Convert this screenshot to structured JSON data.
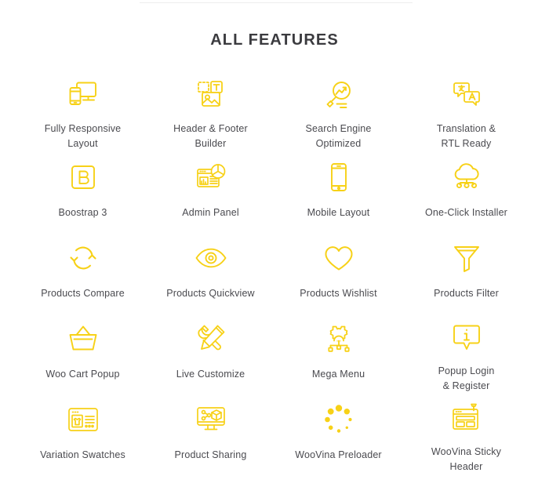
{
  "theme": {
    "icon_color": "#F7D117",
    "title_color": "#3b3b3f",
    "label_color": "#4a4a4f",
    "background": "#ffffff",
    "rule_color": "#ededee"
  },
  "header": {
    "title": "ALL FEATURES"
  },
  "features": [
    {
      "icon": "responsive-devices-icon",
      "label": "Fully Responsive\nLayout"
    },
    {
      "icon": "header-footer-builder-icon",
      "label": "Header & Footer\nBuilder"
    },
    {
      "icon": "magnifier-chart-icon",
      "label": "Search Engine\nOptimized"
    },
    {
      "icon": "translation-bubbles-icon",
      "label": "Translation &\nRTL Ready"
    },
    {
      "icon": "bootstrap-b-icon",
      "label": "Boostrap 3"
    },
    {
      "icon": "dashboard-chart-icon",
      "label": "Admin Panel"
    },
    {
      "icon": "mobile-phone-icon",
      "label": "Mobile Layout"
    },
    {
      "icon": "cloud-install-icon",
      "label": "One-Click Installer"
    },
    {
      "icon": "compare-arrows-icon",
      "label": "Products Compare"
    },
    {
      "icon": "eye-icon",
      "label": "Products Quickview"
    },
    {
      "icon": "heart-icon",
      "label": "Products Wishlist"
    },
    {
      "icon": "funnel-icon",
      "label": "Products Filter"
    },
    {
      "icon": "shopping-basket-icon",
      "label": "Woo Cart Popup"
    },
    {
      "icon": "wrench-pencil-icon",
      "label": "Live Customize"
    },
    {
      "icon": "gear-network-icon",
      "label": "Mega Menu"
    },
    {
      "icon": "info-bubble-icon",
      "label": "Popup Login\n& Register"
    },
    {
      "icon": "swatches-panel-icon",
      "label": "Variation Swatches"
    },
    {
      "icon": "share-monitor-icon",
      "label": "Product Sharing"
    },
    {
      "icon": "spinner-dots-icon",
      "label": "WooVina Preloader"
    },
    {
      "icon": "sticky-header-icon",
      "label": "WooVina Sticky\nHeader"
    }
  ]
}
